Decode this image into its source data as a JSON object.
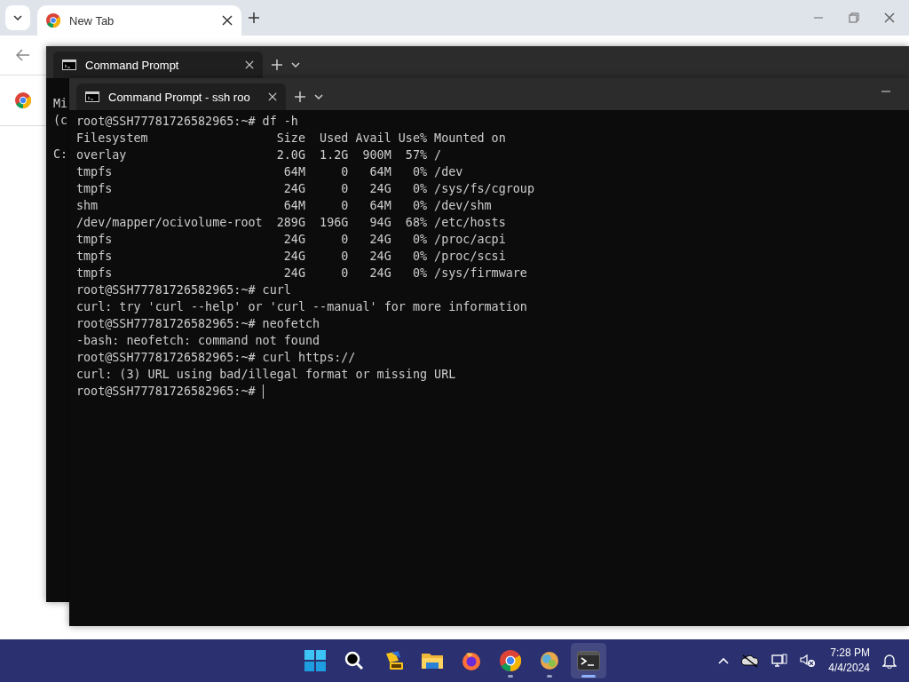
{
  "browser": {
    "tab": {
      "title": "New Tab"
    }
  },
  "back_terminal": {
    "tab": {
      "title": "Command Prompt"
    },
    "lines": [
      "Mi",
      "(c"
    ],
    "prompt": "C:"
  },
  "terminal": {
    "tab": {
      "title": "Command Prompt - ssh  roo"
    },
    "cursor": true,
    "lines": [
      "root@SSH77781726582965:~# df -h",
      "Filesystem                  Size  Used Avail Use% Mounted on",
      "overlay                     2.0G  1.2G  900M  57% /",
      "tmpfs                        64M     0   64M   0% /dev",
      "tmpfs                        24G     0   24G   0% /sys/fs/cgroup",
      "shm                          64M     0   64M   0% /dev/shm",
      "/dev/mapper/ocivolume-root  289G  196G   94G  68% /etc/hosts",
      "tmpfs                        24G     0   24G   0% /proc/acpi",
      "tmpfs                        24G     0   24G   0% /proc/scsi",
      "tmpfs                        24G     0   24G   0% /sys/firmware",
      "root@SSH77781726582965:~# curl",
      "curl: try 'curl --help' or 'curl --manual' for more information",
      "root@SSH77781726582965:~# neofetch",
      "-bash: neofetch: command not found",
      "root@SSH77781726582965:~# curl https://",
      "curl: (3) URL using bad/illegal format or missing URL",
      "root@SSH77781726582965:~# "
    ]
  },
  "taskbar": {
    "apps": [
      {
        "kind": "start",
        "running": false,
        "active": false
      },
      {
        "kind": "search",
        "running": false,
        "active": false
      },
      {
        "kind": "pre",
        "running": false,
        "active": false
      },
      {
        "kind": "folder",
        "running": false,
        "active": false
      },
      {
        "kind": "firefox",
        "running": false,
        "active": false
      },
      {
        "kind": "chrome",
        "running": true,
        "active": false
      },
      {
        "kind": "orb",
        "running": true,
        "active": false
      },
      {
        "kind": "terminal",
        "running": true,
        "active": true
      }
    ],
    "clock": {
      "time": "7:28 PM",
      "date": "4/4/2024"
    }
  }
}
